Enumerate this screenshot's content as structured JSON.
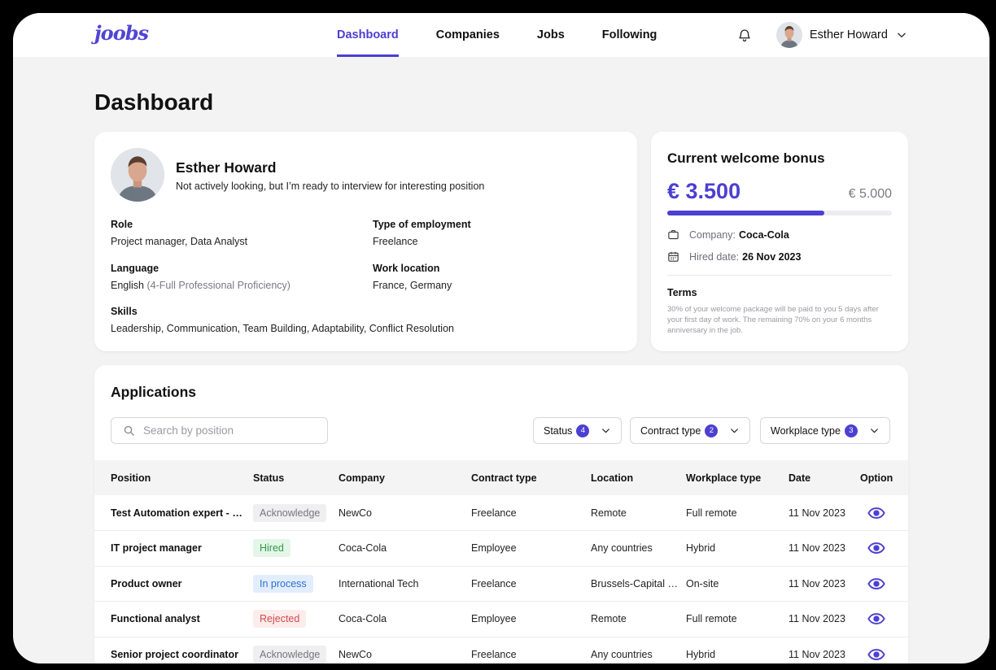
{
  "colors": {
    "accent": "#4c3fd1",
    "hired": "#2f9b48",
    "in_process": "#2d6fd0",
    "rejected": "#d14b4b",
    "acknowledge": "#777777"
  },
  "header": {
    "logo": "joobs",
    "nav": [
      {
        "label": "Dashboard",
        "active": true
      },
      {
        "label": "Companies",
        "active": false
      },
      {
        "label": "Jobs",
        "active": false
      },
      {
        "label": "Following",
        "active": false
      }
    ],
    "notification_icon": "bell-icon",
    "user_name": "Esther Howard",
    "user_menu_icon": "chevron-down-icon"
  },
  "page": {
    "title": "Dashboard"
  },
  "profile": {
    "name": "Esther Howard",
    "status": "Not actively looking, but I’m ready to interview for interesting position",
    "role": {
      "label": "Role",
      "value": "Project manager, Data Analyst"
    },
    "employment": {
      "label": "Type of employment",
      "value": "Freelance"
    },
    "language": {
      "label": "Language",
      "value": "English",
      "detail": "(4-Full Professional Proficiency)"
    },
    "location": {
      "label": "Work location",
      "value": "France, Germany"
    },
    "skills": {
      "label": "Skills",
      "value": "Leadership, Communication, Team Building, Adaptability, Conflict Resolution"
    }
  },
  "bonus": {
    "title": "Current welcome bonus",
    "amount": "€ 3.500",
    "max": "€ 5.000",
    "progress": 0.7,
    "company_label": "Company:",
    "company": "Coca-Cola",
    "hired_label": "Hired date:",
    "hired_date": "26 Nov 2023",
    "terms_title": "Terms",
    "terms_text": "30% of your welcome package will be paid to you 5 days after your first day of work. The remaining 70% on your 6 months anniversary in the job."
  },
  "applications": {
    "title": "Applications",
    "search_placeholder": "Search by position",
    "filters": [
      {
        "label": "Status",
        "count": "4"
      },
      {
        "label": "Contract type",
        "count": "2"
      },
      {
        "label": "Workplace type",
        "count": "3"
      }
    ],
    "columns": [
      "Position",
      "Status",
      "Company",
      "Contract type",
      "Location",
      "Workplace type",
      "Date",
      "Option"
    ],
    "rows": [
      {
        "position": "Test Automation expert - Freelance",
        "status": "Acknowledge",
        "status_type": "ack",
        "company": "NewCo",
        "contract": "Freelance",
        "location": "Remote",
        "workplace": "Full remote",
        "date": "11 Nov 2023"
      },
      {
        "position": "IT project manager",
        "status": "Hired",
        "status_type": "hired",
        "company": "Coca-Cola",
        "contract": "Employee",
        "location": "Any countries",
        "workplace": "Hybrid",
        "date": "11 Nov 2023"
      },
      {
        "position": "Product owner",
        "status": "In process",
        "status_type": "proc",
        "company": "International Tech",
        "contract": "Freelance",
        "location": "Brussels-Capital Region",
        "workplace": "On-site",
        "date": "11 Nov 2023"
      },
      {
        "position": "Functional analyst",
        "status": "Rejected",
        "status_type": "rej",
        "company": "Coca-Cola",
        "contract": "Employee",
        "location": "Remote",
        "workplace": "Full remote",
        "date": "11 Nov 2023"
      },
      {
        "position": "Senior project coordinator",
        "status": "Acknowledge",
        "status_type": "ack",
        "company": "NewCo",
        "contract": "Freelance",
        "location": "Any countries",
        "workplace": "Hybrid",
        "date": "11 Nov 2023"
      }
    ]
  }
}
